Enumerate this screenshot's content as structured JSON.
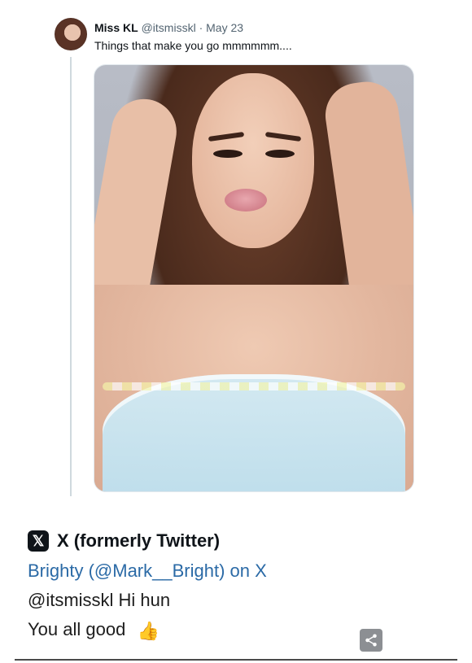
{
  "tweet": {
    "author_name": "Miss KL",
    "author_handle_and_date": "@itsmisskl · May 23",
    "text": "Things that make you go mmmmmm...."
  },
  "embed": {
    "platform_logo_text": "𝕏",
    "platform_title": "X (formerly Twitter)",
    "link_text": "Brighty (@Mark__Bright) on X",
    "line1": "@itsmisskl Hi hun",
    "line2": "You all good",
    "emoji": "👍"
  },
  "icons": {
    "share": "share-icon"
  },
  "colors": {
    "link": "#2b6aa6",
    "text": "#0f1419",
    "meta": "#536471",
    "share_bg": "#8c8f93"
  }
}
